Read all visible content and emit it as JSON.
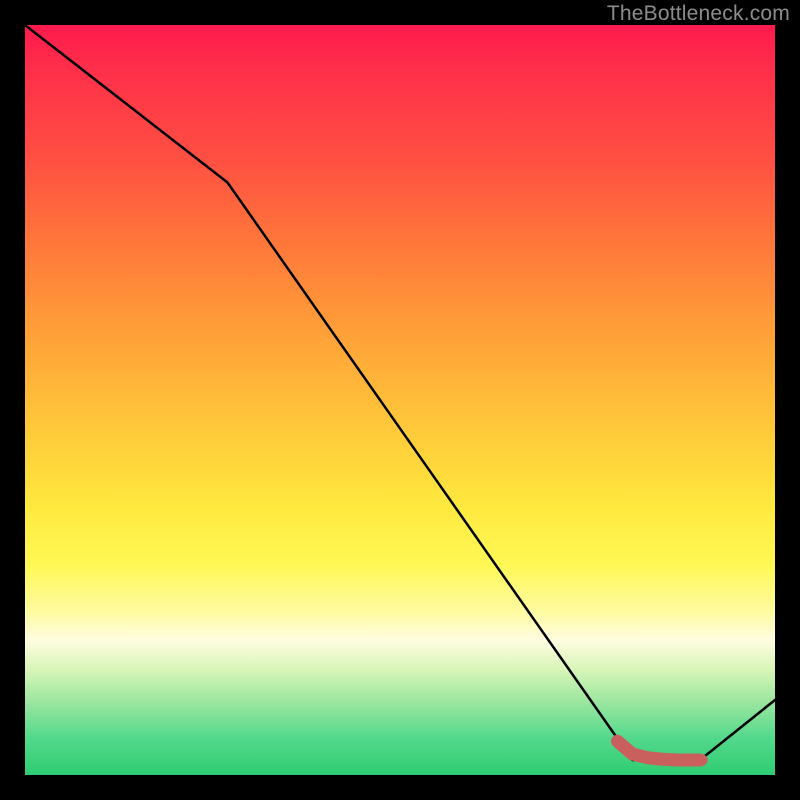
{
  "watermark": "TheBottleneck.com",
  "colors": {
    "background": "#000000",
    "curve": "#000000",
    "marker": "#c9605e",
    "gradient_top": "#ff1a4d",
    "gradient_bottom": "#2ecc71"
  },
  "chart_data": {
    "type": "line",
    "title": "",
    "xlabel": "",
    "ylabel": "",
    "xlim": [
      0,
      100
    ],
    "ylim": [
      0,
      100
    ],
    "grid": false,
    "legend": false,
    "series": [
      {
        "name": "bottleneck-curve",
        "x": [
          0,
          27,
          81,
          90,
          100
        ],
        "y": [
          100,
          79,
          2,
          2,
          10
        ]
      },
      {
        "name": "marker-segment",
        "x": [
          79,
          81,
          83,
          85,
          87,
          89,
          90
        ],
        "y": [
          4.5,
          2.8,
          2.3,
          2.1,
          2.0,
          2.0,
          2.0
        ]
      }
    ]
  }
}
